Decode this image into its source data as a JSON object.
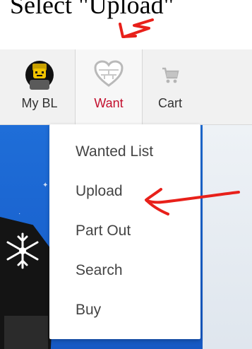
{
  "annotation": {
    "caption": "Select \"Upload\"",
    "arrow_color": "#e8201a"
  },
  "navbar": {
    "items": [
      {
        "label": "My BL",
        "icon": "avatar-icon"
      },
      {
        "label": "Want",
        "icon": "heart-icon",
        "active": true
      },
      {
        "label": "Cart",
        "icon": "cart-icon"
      }
    ]
  },
  "dropdown": {
    "items": [
      {
        "label": "Wanted List"
      },
      {
        "label": "Upload"
      },
      {
        "label": "Part Out"
      },
      {
        "label": "Search"
      },
      {
        "label": "Buy"
      }
    ]
  },
  "colors": {
    "active_label": "#c3102e",
    "banner_blue": "#1f6ed8",
    "navbar_bg": "#f1f1f1"
  }
}
